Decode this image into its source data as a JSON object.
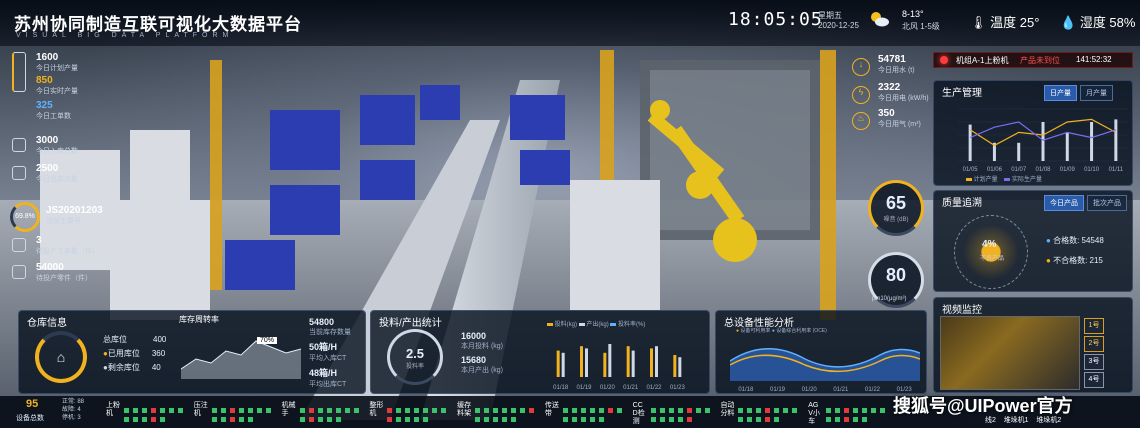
{
  "header": {
    "title": "苏州协同制造互联可视化大数据平台",
    "subtitle": "VISUAL BIG DATA PLATFORM",
    "time": "18:05:05",
    "weekday": "星期五",
    "date": "2020-12-25",
    "temp_range": "8-13°",
    "wind": "北风 1-5级",
    "temperature_label": "温度 25°",
    "humidity_label": "湿度 58%"
  },
  "left_stats": [
    {
      "value": "1600",
      "label": "今日计划产量"
    },
    {
      "value": "850",
      "label": "今日实时产量"
    },
    {
      "value": "325",
      "label": "今日工单数"
    },
    {
      "value": "3000",
      "label": "今日入库总数"
    },
    {
      "value": "2500",
      "label": "今日出库总数"
    },
    {
      "value": "JS20201203",
      "label": "当前工单号",
      "gauge": "69.8%"
    },
    {
      "value": "3",
      "label": "待投产工单数（件）"
    },
    {
      "value": "54000",
      "label": "待投产零件（件）"
    }
  ],
  "energy": [
    {
      "value": "54781",
      "label": "今日用水 (t)"
    },
    {
      "value": "2322",
      "label": "今日用电 (kW/h)"
    },
    {
      "value": "350",
      "label": "今日用气 (m³)"
    }
  ],
  "noise": {
    "value": "65",
    "unit": "噪音 (dB)"
  },
  "pm": {
    "value": "80",
    "unit": "pm10(μg/m³)"
  },
  "alarm": {
    "text": "机组A-1上粉机",
    "status": "产品未到位",
    "time": "141:52:32"
  },
  "production": {
    "title": "生产管理",
    "tabs": [
      "日产量",
      "月产量"
    ],
    "legend": [
      "计划产量",
      "实际生产量"
    ],
    "dates": [
      "01/05",
      "01/06",
      "01/07",
      "01/08",
      "01/09",
      "01/10",
      "01/11"
    ],
    "bars": [
      0.7,
      0.35,
      0.35,
      0.75,
      0.55,
      0.75,
      0.8
    ],
    "planned": [
      0.6,
      0.3,
      0.55,
      0.5,
      0.75,
      0.8,
      0.55
    ],
    "actual": [
      0.45,
      0.65,
      0.75,
      0.4,
      0.55,
      0.45,
      0.6
    ]
  },
  "quality": {
    "title": "质量追溯",
    "tabs": [
      "今日产品",
      "批次产品"
    ],
    "center_value": "4%",
    "center_label": "不良产品",
    "pass_label": "合格数: 54548",
    "fail_label": "不合格数: 215"
  },
  "video": {
    "title": "视频监控",
    "buttons": [
      "1号",
      "2号",
      "3号",
      "4号"
    ],
    "active": 1
  },
  "warehouse": {
    "title": "仓库信息",
    "rows": [
      {
        "label": "总库位",
        "value": "400"
      },
      {
        "label": "已用库位",
        "value": "360"
      },
      {
        "label": "剩余库位",
        "value": "40"
      }
    ],
    "turnover_title": "库存周转率",
    "turnover_badge": "70%",
    "kpis": [
      {
        "value": "54800",
        "label": "当前库存数量"
      },
      {
        "value": "50箱/H",
        "label": "平均入库CT"
      },
      {
        "value": "48箱/H",
        "label": "平均出库CT"
      }
    ]
  },
  "feed": {
    "title": "投料/产出统计",
    "gauge_value": "2.5",
    "gauge_label": "投料率",
    "stats": [
      {
        "value": "16000",
        "label": "本月投料 (kg)"
      },
      {
        "value": "15680",
        "label": "本月产出 (kg)"
      }
    ],
    "legend": [
      "投料(kg)",
      "产出(kg)",
      "投料率(%)"
    ],
    "dates": [
      "01/18",
      "01/19",
      "01/20",
      "01/21",
      "01/22",
      "01/23"
    ],
    "feed_values": [
      0.6,
      0.7,
      0.55,
      0.7,
      0.65,
      0.5
    ],
    "out_values": [
      0.55,
      0.65,
      0.75,
      0.6,
      0.7,
      0.45
    ]
  },
  "oee": {
    "title": "总设备性能分析",
    "legend": [
      "设备可利用率",
      "设备综合利用率 (OCE)"
    ],
    "dates": [
      "01/18",
      "01/19",
      "01/20",
      "01/21",
      "01/22",
      "01/23"
    ]
  },
  "devices": {
    "total_value": "95",
    "total_label": "设备总数",
    "counts": [
      "正常: 88",
      "故障: 4",
      "停机: 3"
    ],
    "groups": [
      "上粉机",
      "压注机",
      "机械手",
      "整形机",
      "缓存料架",
      "传送带",
      "CCD检测",
      "自动分料",
      "AGV小车"
    ]
  },
  "watermark": "搜狐号@UIPower官方",
  "watermark_sub": [
    "线2",
    "堆垛机1",
    "堆垛机2"
  ],
  "colors": {
    "accent": "#f0b21f",
    "blue": "#2a5ba8",
    "green": "#3ac36a",
    "red": "#e23a3a",
    "purple": "#7b6cf0"
  }
}
